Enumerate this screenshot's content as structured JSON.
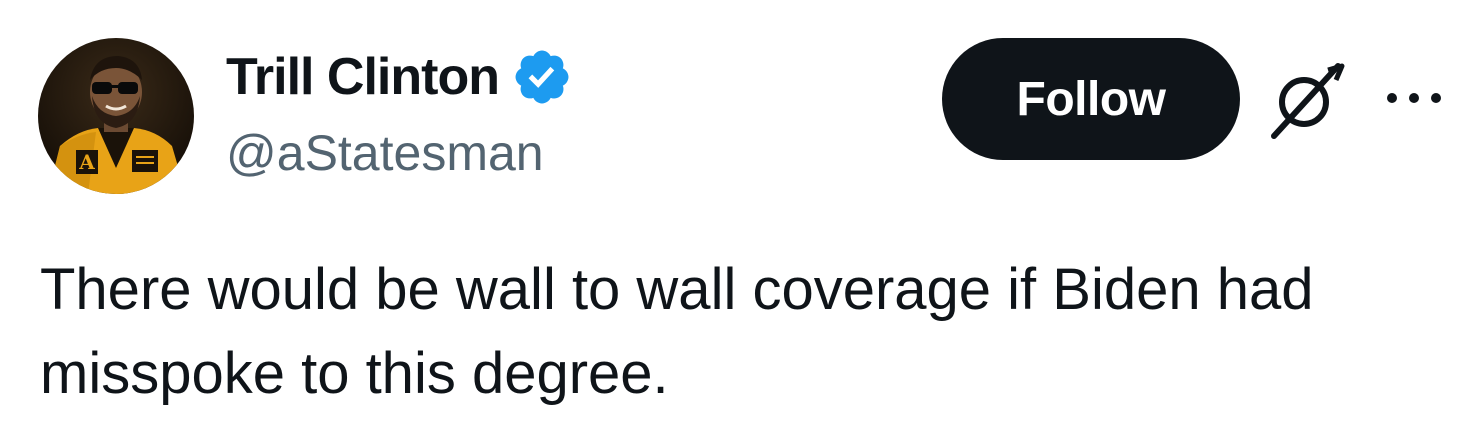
{
  "author": {
    "display_name": "Trill Clinton",
    "handle": "@aStatesman",
    "verified": true,
    "avatar_icon": "profile-photo"
  },
  "actions": {
    "follow_label": "Follow",
    "grok_icon": "grok-icon",
    "more_icon": "more-options-icon"
  },
  "tweet": {
    "text": "There would be wall to wall coverage if Biden had misspoke to this degree."
  },
  "colors": {
    "text_primary": "#0f1419",
    "text_secondary": "#536471",
    "verified_blue": "#1d9bf0",
    "follow_bg": "#0f1419",
    "follow_text": "#ffffff"
  }
}
